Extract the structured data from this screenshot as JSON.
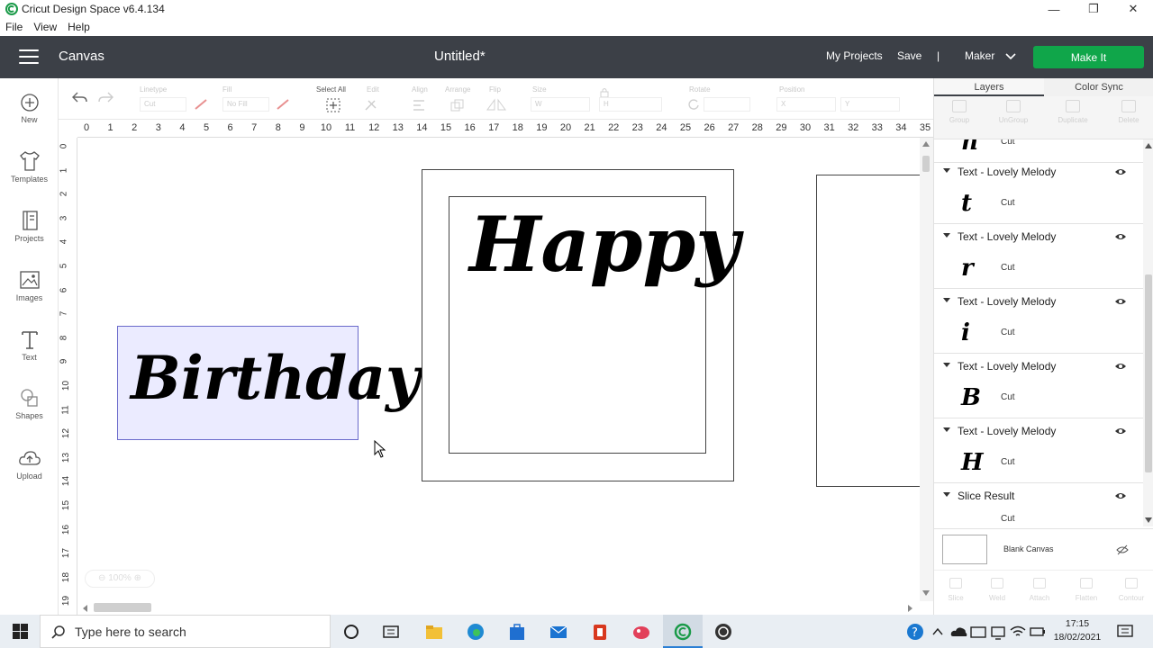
{
  "window": {
    "title": "Cricut Design Space  v6.4.134"
  },
  "menu": [
    "File",
    "View",
    "Help"
  ],
  "header": {
    "section": "Canvas",
    "doc_title": "Untitled*",
    "my_projects": "My Projects",
    "save": "Save",
    "separator": "|",
    "machine": "Maker",
    "make_it": "Make It",
    "accent": "#10a64a"
  },
  "sidebar": [
    {
      "label": "New",
      "icon": "plus-circle-icon"
    },
    {
      "label": "Templates",
      "icon": "tshirt-icon"
    },
    {
      "label": "Projects",
      "icon": "book-icon"
    },
    {
      "label": "Images",
      "icon": "image-icon"
    },
    {
      "label": "Text",
      "icon": "text-icon"
    },
    {
      "label": "Shapes",
      "icon": "shapes-icon"
    },
    {
      "label": "Upload",
      "icon": "cloud-upload-icon"
    }
  ],
  "toolbar": {
    "linetype_label": "Linetype",
    "linetype_value": "Cut",
    "fill_label": "Fill",
    "fill_value": "No Fill",
    "select_all": "Select All",
    "edit": "Edit",
    "align": "Align",
    "arrange": "Arrange",
    "flip": "Flip",
    "size": "Size",
    "w": "W",
    "h": "H",
    "rotate": "Rotate",
    "position": "Position",
    "x": "X",
    "y": "Y"
  },
  "ruler_h": [
    "0",
    "1",
    "2",
    "3",
    "4",
    "5",
    "6",
    "7",
    "8",
    "9",
    "10",
    "11",
    "12",
    "13",
    "14",
    "15",
    "16",
    "17",
    "18",
    "19",
    "20",
    "21",
    "22",
    "23",
    "24",
    "25",
    "26",
    "27",
    "28",
    "29",
    "30",
    "31",
    "32",
    "33",
    "34",
    "35"
  ],
  "ruler_v": [
    "0",
    "1",
    "2",
    "3",
    "4",
    "5",
    "6",
    "7",
    "8",
    "9",
    "10",
    "11",
    "12",
    "13",
    "14",
    "15",
    "16",
    "17",
    "18",
    "19"
  ],
  "canvas": {
    "text1": "Birthday",
    "text2": "Happy",
    "zoom": "100%"
  },
  "panel": {
    "tabs": [
      "Layers",
      "Color Sync"
    ],
    "tools": [
      "Group",
      "UnGroup",
      "Duplicate",
      "Delete"
    ],
    "layers": [
      {
        "name": "Text - Lovely Melody",
        "glyph": "t",
        "op": "Cut"
      },
      {
        "name": "Text - Lovely Melody",
        "glyph": "r",
        "op": "Cut"
      },
      {
        "name": "Text - Lovely Melody",
        "glyph": "i",
        "op": "Cut"
      },
      {
        "name": "Text - Lovely Melody",
        "glyph": "B",
        "op": "Cut"
      },
      {
        "name": "Text - Lovely Melody",
        "glyph": "H",
        "op": "Cut"
      }
    ],
    "partial_top_op": "Cut",
    "slice_result": "Slice Result",
    "slice_op": "Cut",
    "blank_canvas": "Blank Canvas",
    "bottom_tools": [
      "Slice",
      "Weld",
      "Attach",
      "Flatten",
      "Contour"
    ]
  },
  "taskbar": {
    "search_placeholder": "Type here to search",
    "time": "17:15",
    "date": "18/02/2021"
  }
}
